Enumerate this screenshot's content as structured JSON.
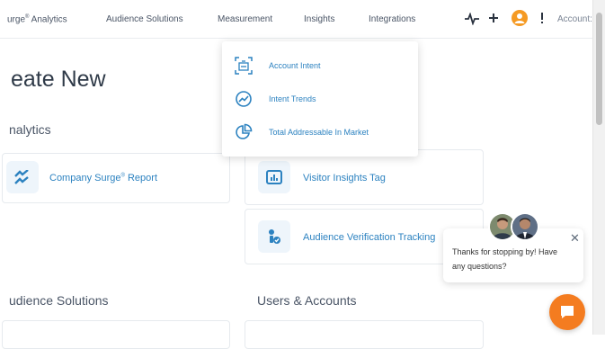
{
  "nav": {
    "items": [
      {
        "label": "urge",
        "sup": "®",
        "label_tail": " Analytics"
      },
      {
        "label": "Audience Solutions"
      },
      {
        "label": "Measurement"
      },
      {
        "label": "Insights"
      },
      {
        "label": "Integrations"
      }
    ],
    "account_label": "Account:"
  },
  "page": {
    "heading": "eate New",
    "sections": {
      "analytics": "nalytics",
      "audience": "udience Solutions",
      "users": "Users & Accounts"
    }
  },
  "cards": {
    "company_surge": {
      "label": "Company Surge",
      "sup": "®",
      "tail": " Report"
    },
    "visitor_insights": {
      "label": "Visitor Insights Tag"
    },
    "audience_verification": {
      "label": "Audience Verification Tracking"
    }
  },
  "dropdown": {
    "items": [
      {
        "label": "Account Intent",
        "icon": "account-intent-icon"
      },
      {
        "label": "Intent Trends",
        "icon": "trend-icon"
      },
      {
        "label": "Total Addressable In Market",
        "icon": "pie-chart-icon"
      }
    ]
  },
  "chat": {
    "message": "Thanks for stopping by! Have any questions?",
    "close_glyph": "✕"
  },
  "colors": {
    "accent": "#2c82c0",
    "brand_orange": "#f59a23",
    "launcher_orange": "#f47c20"
  }
}
